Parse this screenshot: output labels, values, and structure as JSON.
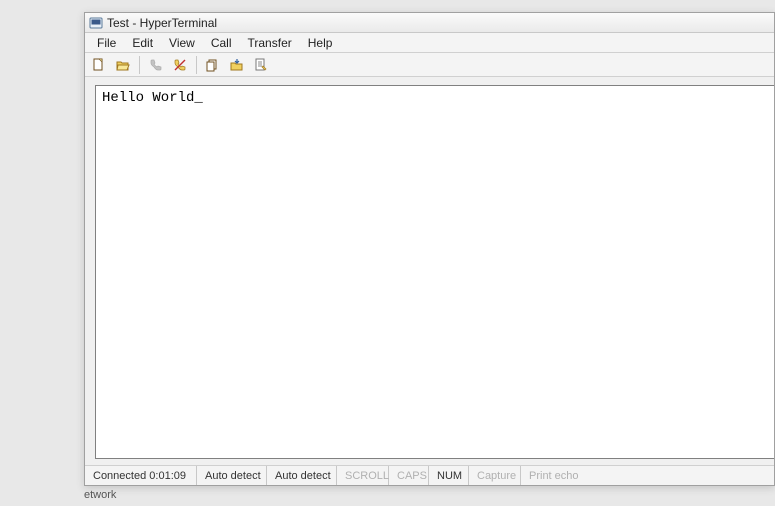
{
  "titlebar": {
    "title": "Test - HyperTerminal",
    "icon": "terminal-app-icon"
  },
  "menubar": {
    "items": [
      {
        "label": "File"
      },
      {
        "label": "Edit"
      },
      {
        "label": "View"
      },
      {
        "label": "Call"
      },
      {
        "label": "Transfer"
      },
      {
        "label": "Help"
      }
    ]
  },
  "toolbar": {
    "buttons": [
      {
        "name": "new-icon"
      },
      {
        "name": "open-icon"
      },
      {
        "name": "call-icon"
      },
      {
        "name": "disconnect-icon"
      },
      {
        "name": "send-icon"
      },
      {
        "name": "receive-icon"
      },
      {
        "name": "properties-icon"
      }
    ]
  },
  "terminal": {
    "content": "Hello World",
    "cursor": "_"
  },
  "statusbar": {
    "connected_label": "Connected",
    "elapsed": "0:01:09",
    "autodetect1": "Auto detect",
    "autodetect2": "Auto detect",
    "scroll": "SCROLL",
    "caps": "CAPS",
    "num": "NUM",
    "capture": "Capture",
    "print_echo": "Print echo"
  },
  "fragment": {
    "label": "etwork"
  }
}
